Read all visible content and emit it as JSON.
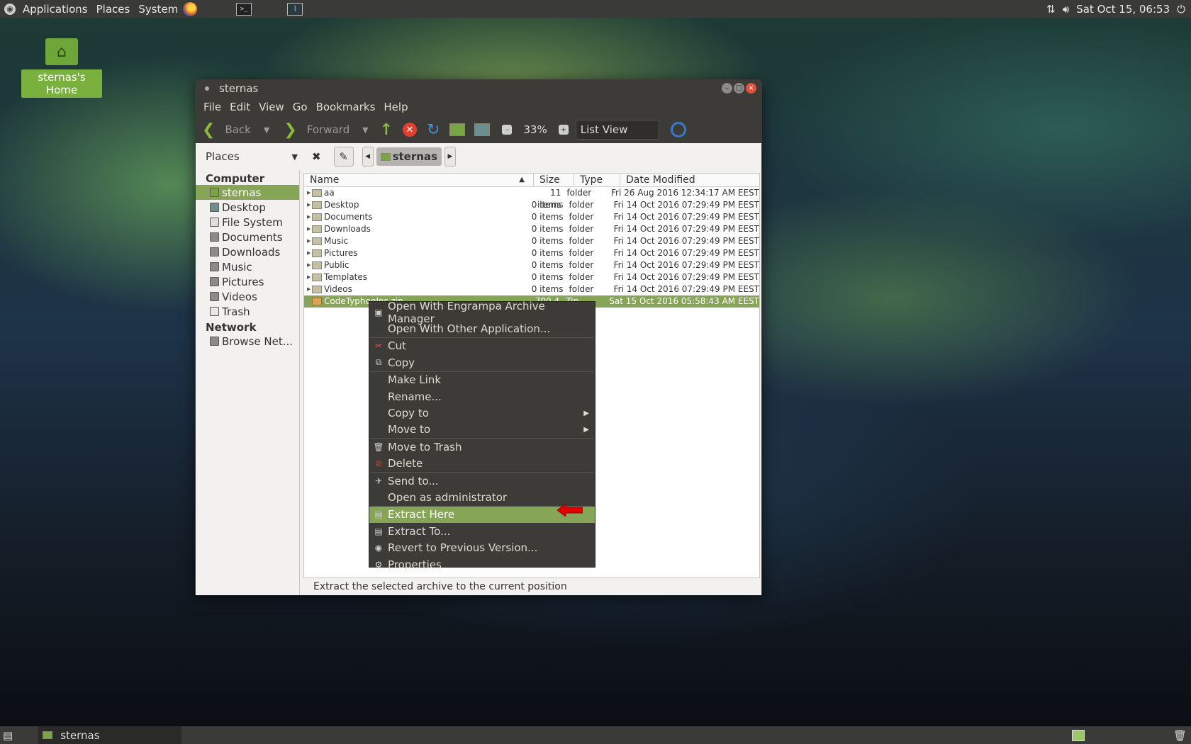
{
  "top_panel": {
    "menus": [
      "Applications",
      "Places",
      "System"
    ],
    "clock": "Sat Oct 15, 06:53"
  },
  "desktop": {
    "home_icon_label": "sternas's Home"
  },
  "window": {
    "title": "sternas",
    "menubar": [
      "File",
      "Edit",
      "View",
      "Go",
      "Bookmarks",
      "Help"
    ],
    "toolbar": {
      "back": "Back",
      "forward": "Forward",
      "zoom": "33%",
      "view": "List View"
    },
    "location": {
      "places_label": "Places",
      "crumb": "sternas"
    },
    "sidebar": {
      "computer_heading": "Computer",
      "computer_items": [
        "sternas",
        "Desktop",
        "File System",
        "Documents",
        "Downloads",
        "Music",
        "Pictures",
        "Videos",
        "Trash"
      ],
      "network_heading": "Network",
      "network_items": [
        "Browse Net..."
      ]
    },
    "columns": [
      "Name",
      "Size",
      "Type",
      "Date Modified"
    ],
    "rows": [
      {
        "name": "aa",
        "size": "11 items",
        "type": "folder",
        "date": "Fri 26 Aug 2016 12:34:17 AM EEST"
      },
      {
        "name": "Desktop",
        "size": "0 items",
        "type": "folder",
        "date": "Fri 14 Oct 2016 07:29:49 PM EEST"
      },
      {
        "name": "Documents",
        "size": "0 items",
        "type": "folder",
        "date": "Fri 14 Oct 2016 07:29:49 PM EEST"
      },
      {
        "name": "Downloads",
        "size": "0 items",
        "type": "folder",
        "date": "Fri 14 Oct 2016 07:29:49 PM EEST"
      },
      {
        "name": "Music",
        "size": "0 items",
        "type": "folder",
        "date": "Fri 14 Oct 2016 07:29:49 PM EEST"
      },
      {
        "name": "Pictures",
        "size": "0 items",
        "type": "folder",
        "date": "Fri 14 Oct 2016 07:29:49 PM EEST"
      },
      {
        "name": "Public",
        "size": "0 items",
        "type": "folder",
        "date": "Fri 14 Oct 2016 07:29:49 PM EEST"
      },
      {
        "name": "Templates",
        "size": "0 items",
        "type": "folder",
        "date": "Fri 14 Oct 2016 07:29:49 PM EEST"
      },
      {
        "name": "Videos",
        "size": "0 items",
        "type": "folder",
        "date": "Fri 14 Oct 2016 07:29:49 PM EEST"
      },
      {
        "name": "CodeTyphonIns.zip",
        "size": "700.4 MB",
        "type": "Zip archive",
        "date": "Sat 15 Oct 2016 05:58:43 AM EEST"
      }
    ],
    "status": "Extract the selected archive to the current position"
  },
  "context_menu": {
    "items": [
      "Open With Engrampa Archive Manager",
      "Open With Other Application...",
      "Cut",
      "Copy",
      "Make Link",
      "Rename...",
      "Copy to",
      "Move to",
      "Move to Trash",
      "Delete",
      "Send to...",
      "Open as administrator",
      "Extract Here",
      "Extract To...",
      "Revert to Previous Version...",
      "Properties"
    ],
    "highlighted": "Extract Here"
  },
  "bottom_panel": {
    "task_label": "sternas"
  },
  "colors": {
    "accent": "#87a556",
    "panel": "#3a3a38",
    "arrow": "#e00000"
  }
}
